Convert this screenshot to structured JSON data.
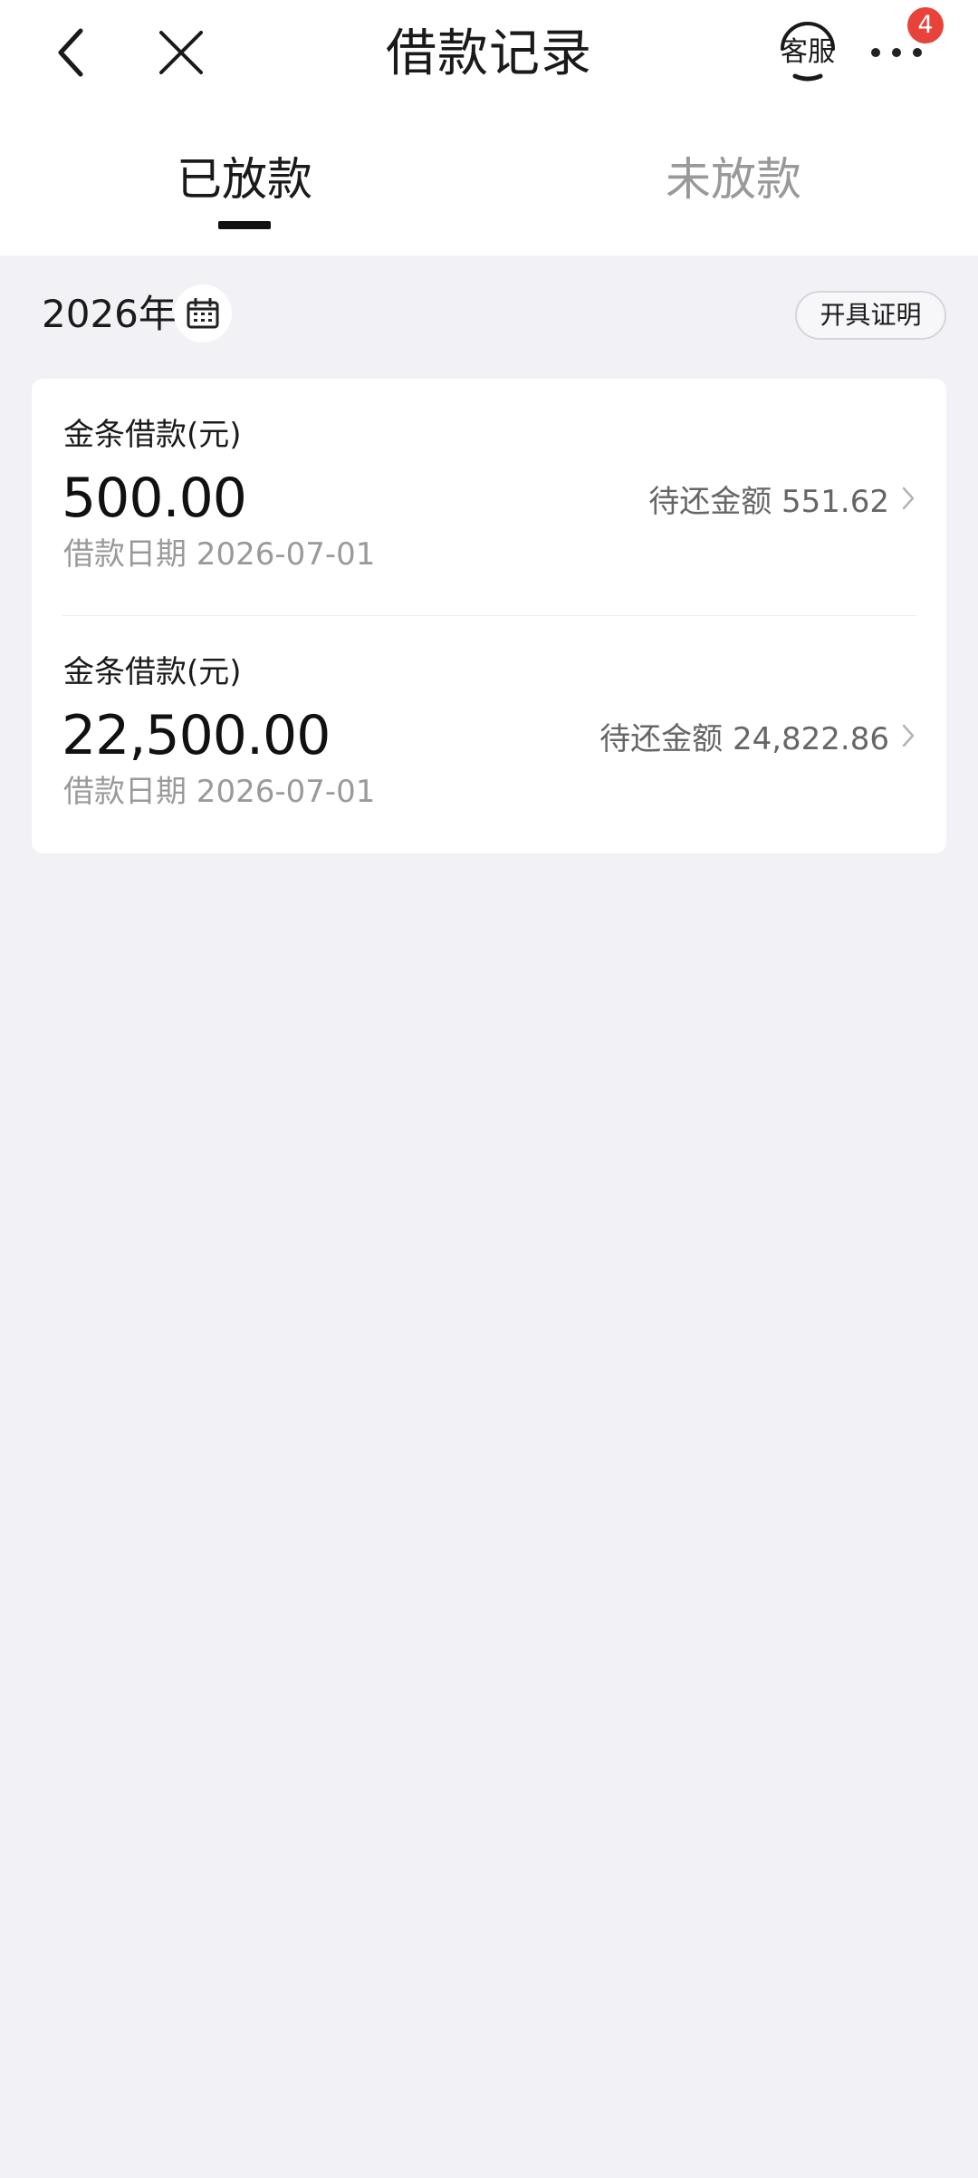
{
  "header": {
    "title": "借款记录",
    "service_label": "客服",
    "notification_count": "4"
  },
  "tabs": [
    {
      "label": "已放款",
      "active": true
    },
    {
      "label": "未放款",
      "active": false
    }
  ],
  "filter": {
    "year": "2026年",
    "certificate_button": "开具证明"
  },
  "loans": [
    {
      "type": "金条借款(元)",
      "amount": "500.00",
      "date": "借款日期 2026-07-01",
      "remaining": "待还金额 551.62"
    },
    {
      "type": "金条借款(元)",
      "amount": "22,500.00",
      "date": "借款日期 2026-07-01",
      "remaining": "待还金额 24,822.86"
    }
  ],
  "colors": {
    "background": "#f1f1f6",
    "badge": "#e8433a",
    "inactive_tab": "#999999"
  }
}
